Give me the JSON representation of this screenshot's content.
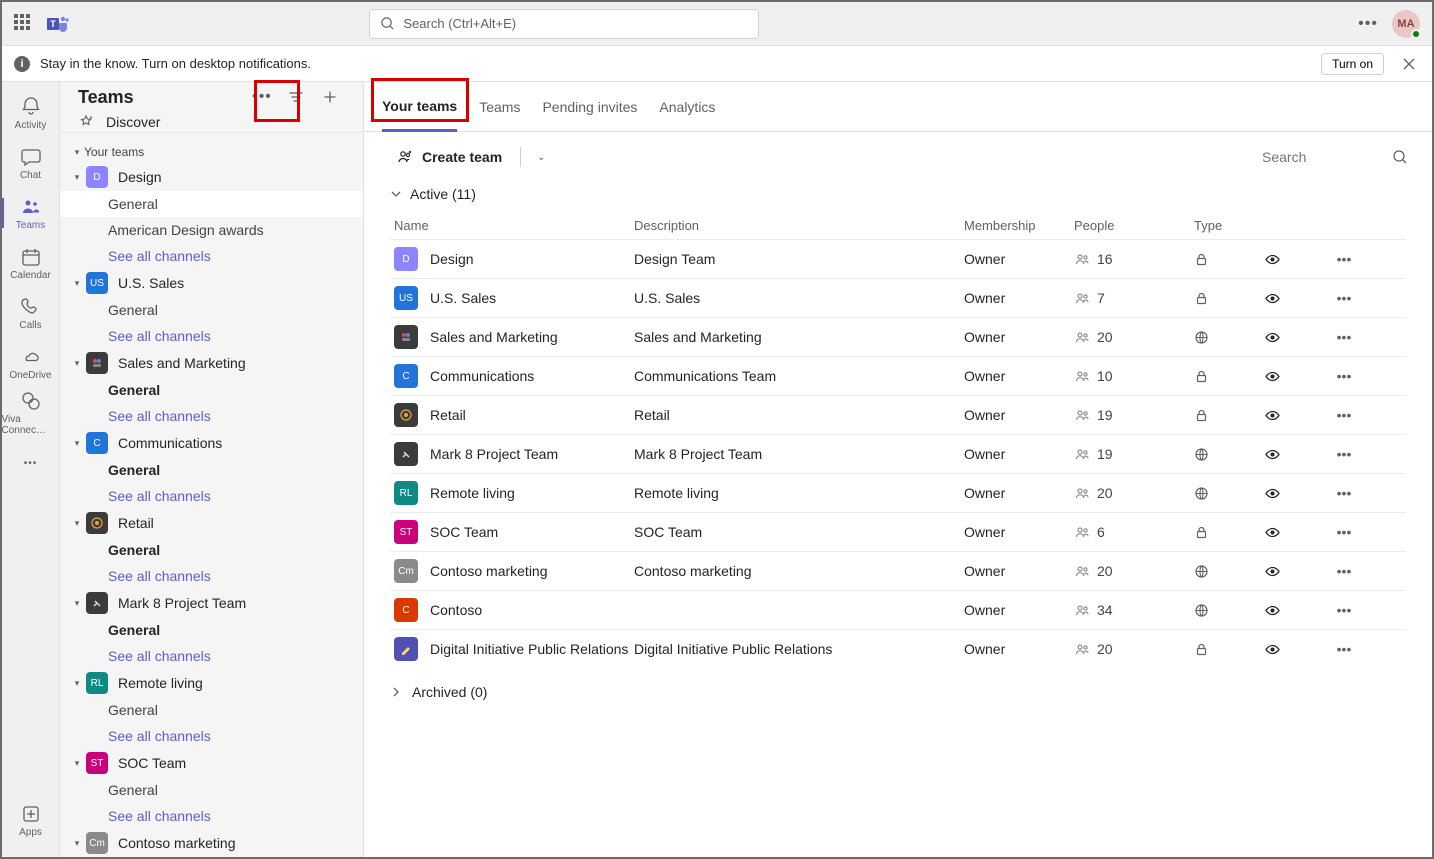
{
  "titlebar": {
    "search_placeholder": "Search (Ctrl+Alt+E)",
    "avatar_initials": "MA"
  },
  "noticebar": {
    "text": "Stay in the know. Turn on desktop notifications.",
    "turn_on": "Turn on"
  },
  "rail": [
    {
      "id": "activity",
      "label": "Activity"
    },
    {
      "id": "chat",
      "label": "Chat"
    },
    {
      "id": "teams",
      "label": "Teams",
      "active": true
    },
    {
      "id": "calendar",
      "label": "Calendar"
    },
    {
      "id": "calls",
      "label": "Calls"
    },
    {
      "id": "onedrive",
      "label": "OneDrive"
    },
    {
      "id": "viva",
      "label": "Viva Connec…"
    }
  ],
  "rail_apps": "Apps",
  "sidebar": {
    "title": "Teams",
    "discover": "Discover",
    "section_label": "Your teams",
    "teams": [
      {
        "name": "Design",
        "color": "#8c85ff",
        "initial": "D",
        "channels": [
          {
            "name": "General",
            "selected": true
          },
          {
            "name": "American Design awards"
          }
        ],
        "see_all": "See all channels"
      },
      {
        "name": "U.S. Sales",
        "color": "#2374d9",
        "initial": "US",
        "channels": [
          {
            "name": "General"
          }
        ],
        "see_all": "See all channels"
      },
      {
        "name": "Sales and Marketing",
        "color": "#3b3b3b",
        "icon": "sm",
        "channels": [
          {
            "name": "General",
            "bold": true
          }
        ],
        "see_all": "See all channels"
      },
      {
        "name": "Communications",
        "color": "#2374d9",
        "initial": "C",
        "channels": [
          {
            "name": "General",
            "bold": true
          }
        ],
        "see_all": "See all channels"
      },
      {
        "name": "Retail",
        "color": "#3b3b3b",
        "icon": "retail",
        "channels": [
          {
            "name": "General",
            "bold": true
          }
        ],
        "see_all": "See all channels"
      },
      {
        "name": "Mark 8 Project Team",
        "color": "#3b3b3b",
        "icon": "m8",
        "channels": [
          {
            "name": "General",
            "bold": true
          }
        ],
        "see_all": "See all channels"
      },
      {
        "name": "Remote living",
        "color": "#0f8a82",
        "initial": "RL",
        "channels": [
          {
            "name": "General"
          }
        ],
        "see_all": "See all channels"
      },
      {
        "name": "SOC Team",
        "color": "#c9007a",
        "initial": "ST",
        "channels": [
          {
            "name": "General"
          }
        ],
        "see_all": "See all channels"
      },
      {
        "name": "Contoso marketing",
        "color": "#8a8a8a",
        "initial": "Cm",
        "channels": []
      }
    ]
  },
  "tabs": [
    {
      "label": "Your teams",
      "active": true
    },
    {
      "label": "Teams"
    },
    {
      "label": "Pending invites"
    },
    {
      "label": "Analytics"
    }
  ],
  "toolbar": {
    "create": "Create team",
    "search_placeholder": "Search"
  },
  "group": {
    "active": "Active (11)",
    "archived": "Archived (0)"
  },
  "columns": {
    "name": "Name",
    "description": "Description",
    "membership": "Membership",
    "people": "People",
    "type": "Type"
  },
  "rows": [
    {
      "name": "Design",
      "desc": "Design Team",
      "membership": "Owner",
      "people": "16",
      "type": "lock",
      "color": "#8c85ff",
      "initial": "D"
    },
    {
      "name": "U.S. Sales",
      "desc": "U.S. Sales",
      "membership": "Owner",
      "people": "7",
      "type": "lock",
      "color": "#2374d9",
      "initial": "US"
    },
    {
      "name": "Sales and Marketing",
      "desc": "Sales and Marketing",
      "membership": "Owner",
      "people": "20",
      "type": "globe",
      "color": "#3b3b3b",
      "icon": "sm"
    },
    {
      "name": "Communications",
      "desc": "Communications Team",
      "membership": "Owner",
      "people": "10",
      "type": "lock",
      "color": "#2374d9",
      "initial": "C"
    },
    {
      "name": "Retail",
      "desc": "Retail",
      "membership": "Owner",
      "people": "19",
      "type": "lock",
      "color": "#3b3b3b",
      "icon": "retail"
    },
    {
      "name": "Mark 8 Project Team",
      "desc": "Mark 8 Project Team",
      "membership": "Owner",
      "people": "19",
      "type": "globe",
      "color": "#3b3b3b",
      "icon": "m8"
    },
    {
      "name": "Remote living",
      "desc": "Remote living",
      "membership": "Owner",
      "people": "20",
      "type": "globe",
      "color": "#0f8a82",
      "initial": "RL"
    },
    {
      "name": "SOC Team",
      "desc": "SOC Team",
      "membership": "Owner",
      "people": "6",
      "type": "lock",
      "color": "#c9007a",
      "initial": "ST"
    },
    {
      "name": "Contoso marketing",
      "desc": "Contoso marketing",
      "membership": "Owner",
      "people": "20",
      "type": "globe",
      "color": "#8a8a8a",
      "initial": "Cm"
    },
    {
      "name": "Contoso",
      "desc": "",
      "membership": "Owner",
      "people": "34",
      "type": "globe",
      "color": "#d83b01",
      "initial": "C"
    },
    {
      "name": "Digital Initiative Public Relations",
      "desc": "Digital Initiative Public Relations",
      "membership": "Owner",
      "people": "20",
      "type": "lock",
      "color": "#4f52b2",
      "icon": "pen"
    }
  ]
}
